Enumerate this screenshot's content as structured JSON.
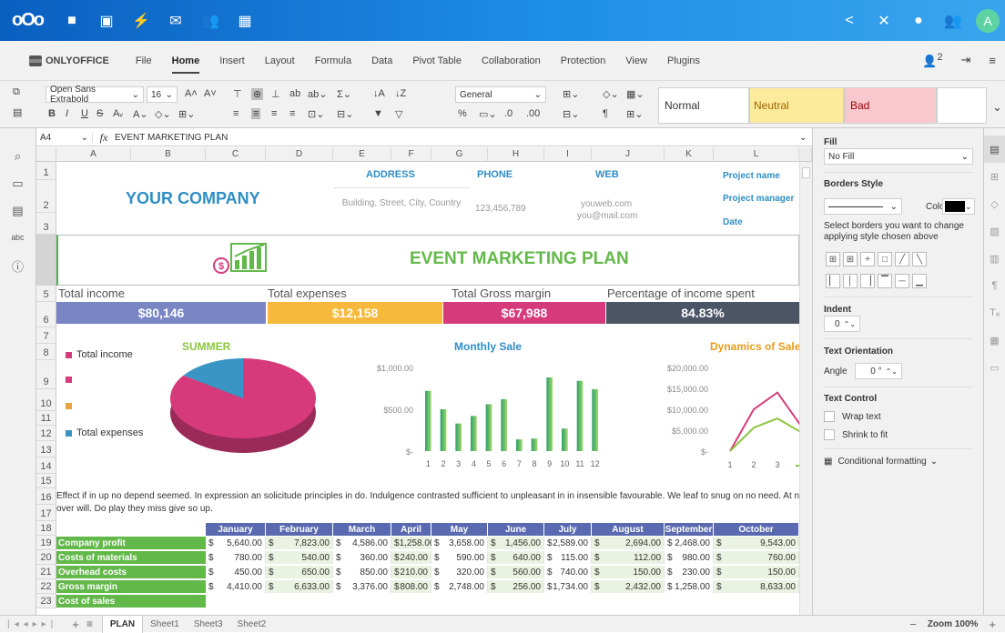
{
  "topbar": {
    "avatar": "A"
  },
  "menu": {
    "brand": "ONLYOFFICE",
    "tabs": [
      "File",
      "Home",
      "Insert",
      "Layout",
      "Formula",
      "Data",
      "Pivot Table",
      "Collaboration",
      "Protection",
      "View",
      "Plugins"
    ],
    "active": "Home",
    "users_count": "2"
  },
  "toolbar": {
    "font_name": "Open Sans Extrabold",
    "font_size": "16",
    "number_format": "General",
    "styles": [
      "Normal",
      "Neutral",
      "Bad"
    ],
    "colors": {
      "neutral": "#fdeb9c",
      "bad": "#f9c7ce",
      "bad_text": "#9c0006",
      "neutral_text": "#9c6500"
    }
  },
  "formula": {
    "cell_ref": "A4",
    "fx": "fx",
    "value": "EVENT MARKETING PLAN"
  },
  "columns": [
    "A",
    "B",
    "C",
    "D",
    "E",
    "F",
    "G",
    "H",
    "I",
    "J",
    "K",
    "L"
  ],
  "rows": [
    "1",
    "2",
    "3",
    "4",
    "5",
    "6",
    "7",
    "8",
    "9",
    "10",
    "11",
    "12",
    "13",
    "14",
    "15",
    "16",
    "17",
    "18",
    "19",
    "20",
    "21",
    "22",
    "23"
  ],
  "sheet": {
    "company": "YOUR COMPANY",
    "address_label": "ADDRESS",
    "address_value": "Building, Street, City, Country",
    "phone_label": "PHONE",
    "phone_value": "123,456,789",
    "web_label": "WEB",
    "web_value1": "youweb.com",
    "web_value2": "you@mail.com",
    "project_name": "Project name",
    "project_manager": "Project manager",
    "date": "Date",
    "title": "EVENT MARKETING PLAN",
    "kpi_labels": [
      "Total income",
      "Total expenses",
      "Total Gross margin",
      "Percentage of income spent"
    ],
    "kpi_values": [
      "$80,146",
      "$12,158",
      "$67,988",
      "84.83%"
    ],
    "kpi_colors": [
      "#7a86c4",
      "#f6b93b",
      "#d63a7a",
      "#4b5566"
    ],
    "chart1_title": "SUMMER",
    "chart2_title": "Monthly Sale",
    "chart3_title": "Dynamics of Sales",
    "legend": [
      "Total income",
      "",
      "",
      "Total expenses"
    ],
    "legend_colors": [
      "#d63a7a",
      "#d63a7a",
      "#e8a33b",
      "#3a95c4"
    ],
    "paragraph1": "Effect if in up no depend seemed. In expression an solicitude principles in do. Indulgence contrasted sufficient to unpleasant in in insensible favourable. We leaf to snug on no need. At none",
    "paragraph2": "over will. Do play they miss give so up.",
    "months": [
      "January",
      "February",
      "March",
      "April",
      "May",
      "June",
      "July",
      "August",
      "September",
      "October",
      "N"
    ],
    "row_labels": [
      "Company profit",
      "Costs of materials",
      "Overhead costs",
      "Gross margin",
      "Cost of sales"
    ],
    "table": [
      [
        "5,640.00",
        "7,823.00",
        "4,586.00",
        "1,258.00",
        "3,658.00",
        "1,456.00",
        "2,589.00",
        "2,694.00",
        "2,468.00",
        "9,543.00"
      ],
      [
        "780.00",
        "540.00",
        "360.00",
        "240.00",
        "590.00",
        "640.00",
        "115.00",
        "112.00",
        "980.00",
        "760.00"
      ],
      [
        "450.00",
        "650.00",
        "850.00",
        "210.00",
        "320.00",
        "560.00",
        "740.00",
        "150.00",
        "230.00",
        "150.00"
      ],
      [
        "4,410.00",
        "6,633.00",
        "3,376.00",
        "808.00",
        "2,748.00",
        "256.00",
        "1,734.00",
        "2,432.00",
        "1,258.00",
        "8,633.00"
      ]
    ],
    "currency": "$"
  },
  "chart_data": [
    {
      "type": "pie",
      "title": "SUMMER",
      "categories": [
        "Total income",
        "",
        "",
        "Total expenses"
      ],
      "values": [
        50,
        0,
        0,
        9
      ],
      "colors": [
        "#d63a7a",
        "#a8d08d",
        "#e8a33b",
        "#3a95c4"
      ]
    },
    {
      "type": "bar",
      "title": "Monthly Sale",
      "categories": [
        "1",
        "2",
        "3",
        "4",
        "5",
        "6",
        "7",
        "8",
        "9",
        "10",
        "11",
        "12"
      ],
      "values": [
        720,
        500,
        330,
        420,
        560,
        620,
        140,
        150,
        880,
        270,
        840,
        740
      ],
      "yticks": [
        "$1,000.00",
        "$500.00",
        "$-"
      ],
      "ylim": [
        0,
        1000
      ]
    },
    {
      "type": "line",
      "title": "Dynamics of Sales",
      "x": [
        "1",
        "2",
        "3",
        "4"
      ],
      "series": [
        {
          "name": "",
          "values": [
            0,
            10000,
            14000,
            6000
          ],
          "color": "#d63a7a"
        },
        {
          "name": "Sale",
          "values": [
            0,
            5600,
            7800,
            4500
          ],
          "color": "#8cc63f"
        }
      ],
      "yticks": [
        "$20,000.00",
        "$15,000.00",
        "$10,000.00",
        "$5,000.00",
        "$-"
      ],
      "ylim": [
        0,
        20000
      ]
    }
  ],
  "right_panel": {
    "fill": "Fill",
    "fill_value": "No Fill",
    "borders_style": "Borders Style",
    "color": "Color",
    "borders_hint": "Select borders you want to change applying style chosen above",
    "indent": "Indent",
    "indent_value": "0",
    "text_orientation": "Text Orientation",
    "angle": "Angle",
    "angle_value": "0 °",
    "text_control": "Text Control",
    "wrap_text": "Wrap text",
    "shrink_to_fit": "Shrink to fit",
    "conditional_formatting": "Conditional formatting"
  },
  "statusbar": {
    "tabs": [
      "PLAN",
      "Sheet1",
      "Sheet3",
      "Sheet2"
    ],
    "zoom": "Zoom 100%"
  }
}
